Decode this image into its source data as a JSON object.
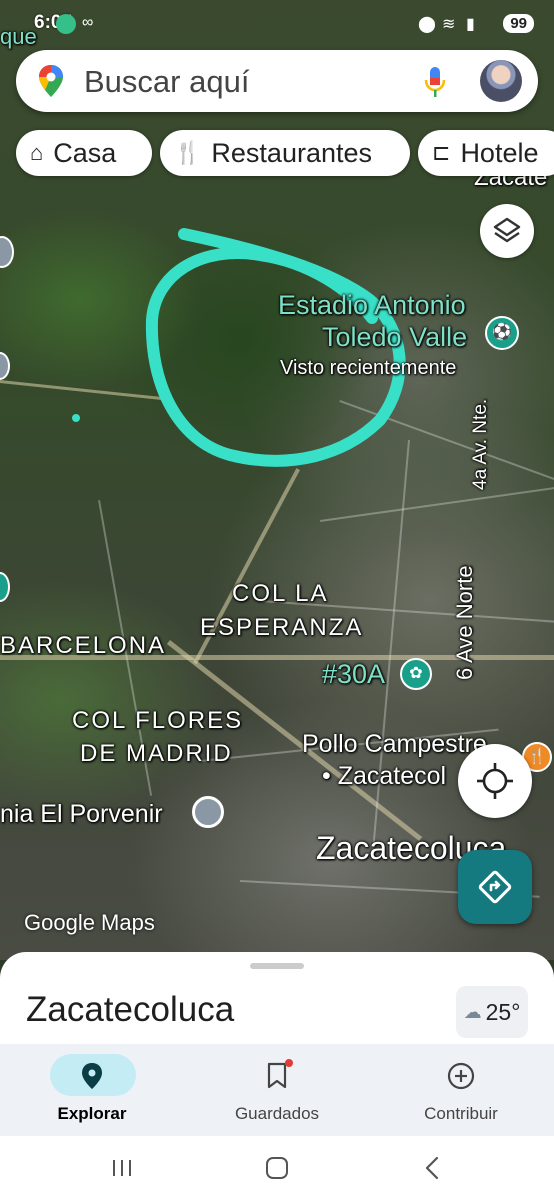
{
  "status_bar": {
    "time": "6:05",
    "battery": "99"
  },
  "search": {
    "placeholder": "Buscar aquí"
  },
  "chips": [
    {
      "label": "Casa",
      "icon": "home-icon"
    },
    {
      "label": "Restaurantes",
      "icon": "fork-knife-icon"
    },
    {
      "label": "Hotele",
      "icon": "bed-icon"
    }
  ],
  "map_labels": {
    "edge_top_left": "que",
    "edge_top_right": "Zacate",
    "estadio_line1": "Estadio Antonio",
    "estadio_line2": "Toledo Valle",
    "estadio_sub": "Visto recientemente",
    "ave_4a": "4a Av. Nte.",
    "ave_6": "6 Ave Norte",
    "col_esperanza_1": "COL LA",
    "col_esperanza_2": "ESPERANZA",
    "barcelona": "BARCELONA",
    "route_30a": "#30A",
    "col_flores_1": "COL FLORES",
    "col_flores_2": "DE MADRID",
    "pollo_1": "Pollo Campestre",
    "pollo_2": "• Zacatecol",
    "porvenir": "nia El Porvenir",
    "zacatecoluca_map": "Zacatecoluca",
    "google_maps": "Google Maps"
  },
  "place": {
    "name": "Zacatecoluca",
    "temperature": "25°",
    "weather_icon": "partly-cloudy-icon"
  },
  "bottom_nav": [
    {
      "label": "Explorar",
      "icon": "location-pin-icon",
      "active": true
    },
    {
      "label": "Guardados",
      "icon": "bookmark-icon",
      "active": false
    },
    {
      "label": "Contribuir",
      "icon": "add-circle-icon",
      "active": false
    }
  ],
  "colors": {
    "accent": "#147a80",
    "annotation": "#38e0c8",
    "nav_active_pill": "#c3ecf4"
  }
}
